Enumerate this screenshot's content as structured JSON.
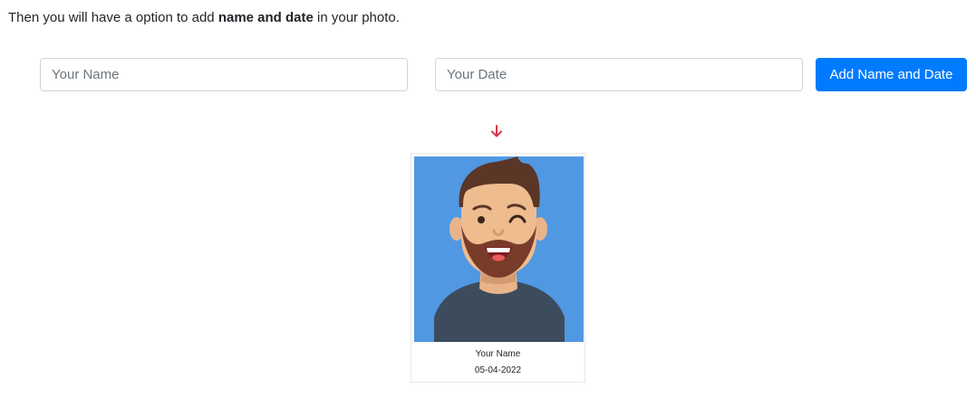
{
  "intro": {
    "text_before": "Then you will have a option to add ",
    "text_bold": "name and date",
    "text_after": " in your photo."
  },
  "form": {
    "name_placeholder": "Your Name",
    "name_value": "",
    "date_placeholder": "Your Date",
    "date_value": "",
    "submit_label": "Add Name and Date"
  },
  "arrow": {
    "icon": "arrow-down-icon",
    "color": "#dc3545"
  },
  "card": {
    "name": "Your Name",
    "date": "05-04-2022",
    "photo_background": "#5198e3"
  },
  "colors": {
    "primary": "#007bff",
    "input_border": "#ced4da"
  }
}
